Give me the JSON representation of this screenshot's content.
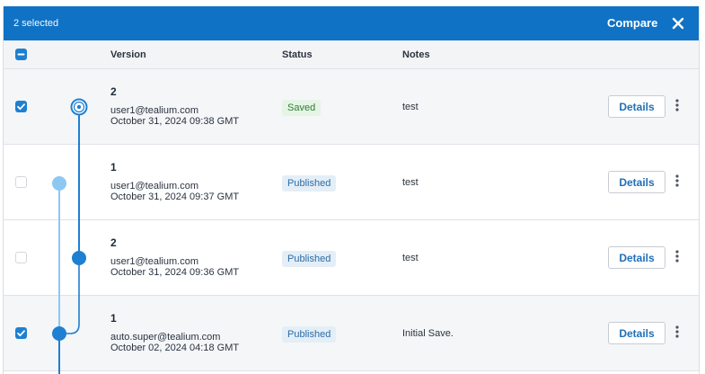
{
  "toolbar": {
    "selected_text": "2 selected",
    "compare_label": "Compare",
    "close_icon": "close-icon"
  },
  "columns": {
    "version": "Version",
    "status": "Status",
    "notes": "Notes"
  },
  "colors": {
    "accent": "#1072c5",
    "node_dark": "#1f7fd1",
    "node_light": "#8cc8f2"
  },
  "rows": [
    {
      "version": "2",
      "user": "user1@tealium.com",
      "date": "October 31, 2024 09:38 GMT",
      "status": "Saved",
      "notes": "test",
      "details": "Details",
      "checked": true
    },
    {
      "version": "1",
      "user": "user1@tealium.com",
      "date": "October 31, 2024 09:37 GMT",
      "status": "Published",
      "notes": "test",
      "details": "Details",
      "checked": false
    },
    {
      "version": "2",
      "user": "user1@tealium.com",
      "date": "October 31, 2024 09:36 GMT",
      "status": "Published",
      "notes": "test",
      "details": "Details",
      "checked": false
    },
    {
      "version": "1",
      "user": "auto.super@tealium.com",
      "date": "October 02, 2024 04:18 GMT",
      "status": "Published",
      "notes": "Initial Save.",
      "details": "Details",
      "checked": true
    }
  ]
}
